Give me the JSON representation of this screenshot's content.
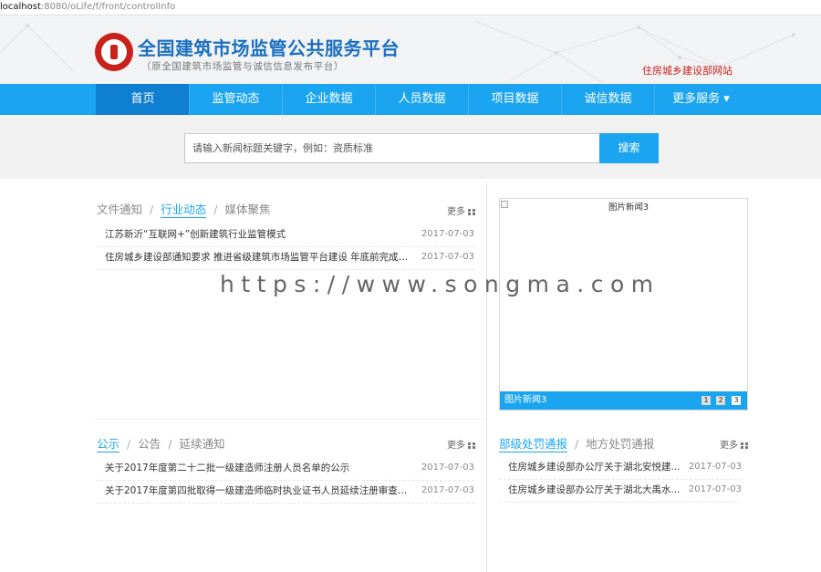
{
  "browser": {
    "url_host": "localhost",
    "url_rest": ":8080/oLife/f/front/controlInfo"
  },
  "header": {
    "title": "全国建筑市场监管公共服务平台",
    "subtitle": "（原全国建筑市场监管与诚信信息发布平台）",
    "ministry_link": "住房城乡建设部网站",
    "logo_color": "#c9221a",
    "title_color": "#1a6fc0"
  },
  "nav": {
    "color": "#1ba5f0",
    "active_color": "#0f7fd1",
    "items": [
      {
        "label": "首页"
      },
      {
        "label": "监管动态"
      },
      {
        "label": "企业数据"
      },
      {
        "label": "人员数据"
      },
      {
        "label": "项目数据"
      },
      {
        "label": "诚信数据"
      },
      {
        "label": "更多服务 ▾"
      }
    ]
  },
  "search": {
    "placeholder": "请输入新闻标题关键字，例如：资质标准",
    "button": "搜索"
  },
  "news_panel": {
    "tabs": [
      "文件通知",
      "行业动态",
      "媒体聚焦"
    ],
    "active_tab": "行业动态",
    "more": "更多",
    "items": [
      {
        "title": "江苏新沂“互联网+”创新建筑行业监管模式",
        "date": "2017-07-03"
      },
      {
        "title": "住房城乡建设部通知要求 推进省级建筑市场监管平台建设 年底前完成信...",
        "date": "2017-07-03"
      }
    ]
  },
  "photo_news": {
    "alt_text": "图片新闻3",
    "caption": "图片新闻3",
    "pages": [
      "1",
      "2",
      "3"
    ],
    "current_page": "3"
  },
  "notice_panel": {
    "tabs": [
      "公示",
      "公告",
      "延续通知"
    ],
    "active_tab": "公示",
    "more": "更多",
    "items": [
      {
        "title": "关于2017年度第二十二批一级建造师注册人员名单的公示",
        "date": "2017-07-03"
      },
      {
        "title": "关于2017年度第四批取得一级建造师临时执业证书人员延续注册审查结...",
        "date": "2017-07-03"
      }
    ]
  },
  "penalty_panel": {
    "tabs": [
      "部级处罚通报",
      "地方处罚通报"
    ],
    "active_tab": "部级处罚通报",
    "more": "更多",
    "items": [
      {
        "title": "住房城乡建设部办公厅关于湖北安悦建...",
        "date": "2017-07-03"
      },
      {
        "title": "住房城乡建设部办公厅关于湖北大禹水...",
        "date": "2017-07-03"
      }
    ]
  },
  "watermark": "https://www.songma.com"
}
